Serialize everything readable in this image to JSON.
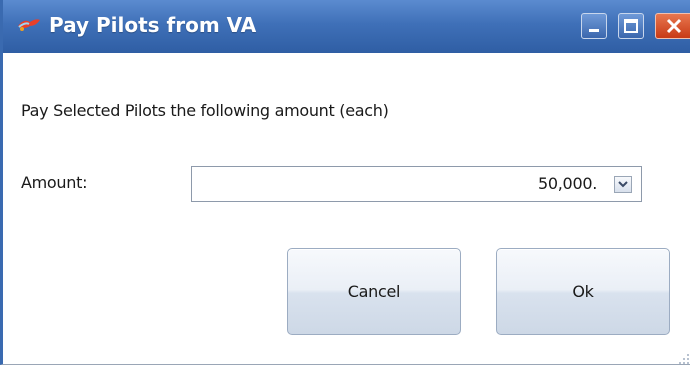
{
  "window": {
    "title": "Pay Pilots from VA",
    "icon": "app-logo-icon",
    "controls": [
      "minimize-icon",
      "maximize-icon",
      "close-icon"
    ]
  },
  "dialog": {
    "prompt": "Pay Selected Pilots the following amount (each)",
    "amount_label": "Amount:",
    "amount_value": "50,000.",
    "cancel_label": "Cancel",
    "ok_label": "Ok"
  },
  "colors": {
    "titlebar": "#3f70b8",
    "close_button": "#c83a16",
    "button_face": "#e3e9f2"
  }
}
